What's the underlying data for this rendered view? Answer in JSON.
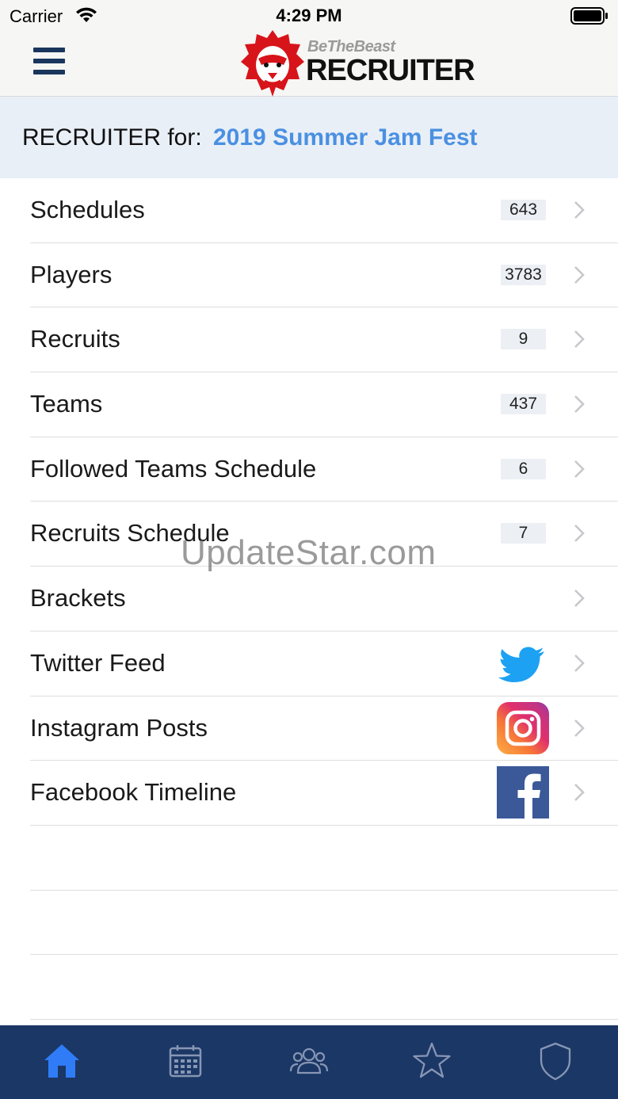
{
  "status_bar": {
    "carrier": "Carrier",
    "time": "4:29 PM"
  },
  "header": {
    "brand_small": "BeTheBeast",
    "brand_big": "RECRUITER"
  },
  "banner": {
    "prefix": "RECRUITER for:",
    "event_name": "2019 Summer Jam Fest"
  },
  "menu": [
    {
      "label": "Schedules",
      "count": "643"
    },
    {
      "label": "Players",
      "count": "3783"
    },
    {
      "label": "Recruits",
      "count": "9"
    },
    {
      "label": "Teams",
      "count": "437"
    },
    {
      "label": "Followed Teams Schedule",
      "count": "6"
    },
    {
      "label": "Recruits Schedule",
      "count": "7"
    },
    {
      "label": "Brackets"
    },
    {
      "label": "Twitter Feed",
      "icon": "twitter-icon"
    },
    {
      "label": "Instagram Posts",
      "icon": "instagram-icon"
    },
    {
      "label": "Facebook Timeline",
      "icon": "facebook-icon"
    }
  ],
  "watermark": "UpdateStar.com",
  "tabs": [
    {
      "icon": "home-icon",
      "active": true
    },
    {
      "icon": "calendar-icon",
      "active": false
    },
    {
      "icon": "people-icon",
      "active": false
    },
    {
      "icon": "star-icon",
      "active": false
    },
    {
      "icon": "shield-icon",
      "active": false
    }
  ],
  "colors": {
    "accent": "#4a90e2",
    "navy": "#1b3766",
    "header_bg": "#f6f6f4",
    "banner_bg": "#e9eff7",
    "tab_active": "#2f7cf6",
    "tab_inactive": "#8796b3",
    "brand_red": "#d7141a"
  }
}
